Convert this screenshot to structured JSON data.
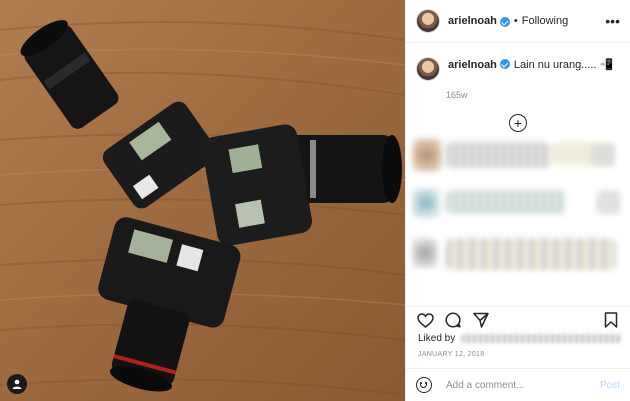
{
  "post": {
    "username": "arielnoah",
    "follow_status": "Following",
    "follow_dot": "•",
    "caption": "Lain nu urang..... 📲",
    "time_ago": "165w",
    "liked_by_label": "Liked by",
    "date": "JANUARY 12, 2018",
    "comment_placeholder": "Add a comment...",
    "post_label": "Post",
    "more_glyph": "•••",
    "load_more_glyph": "+"
  },
  "icons": [
    "user-tag-icon",
    "verified-badge-icon",
    "more-options-icon",
    "load-more-comments-icon",
    "heart-icon",
    "comment-icon",
    "share-icon",
    "save-bookmark-icon",
    "emoji-icon"
  ],
  "colors": {
    "accent": "#3897f0",
    "post_disabled": "#b3dbff",
    "text": "#262626",
    "muted": "#8e8e8e"
  }
}
